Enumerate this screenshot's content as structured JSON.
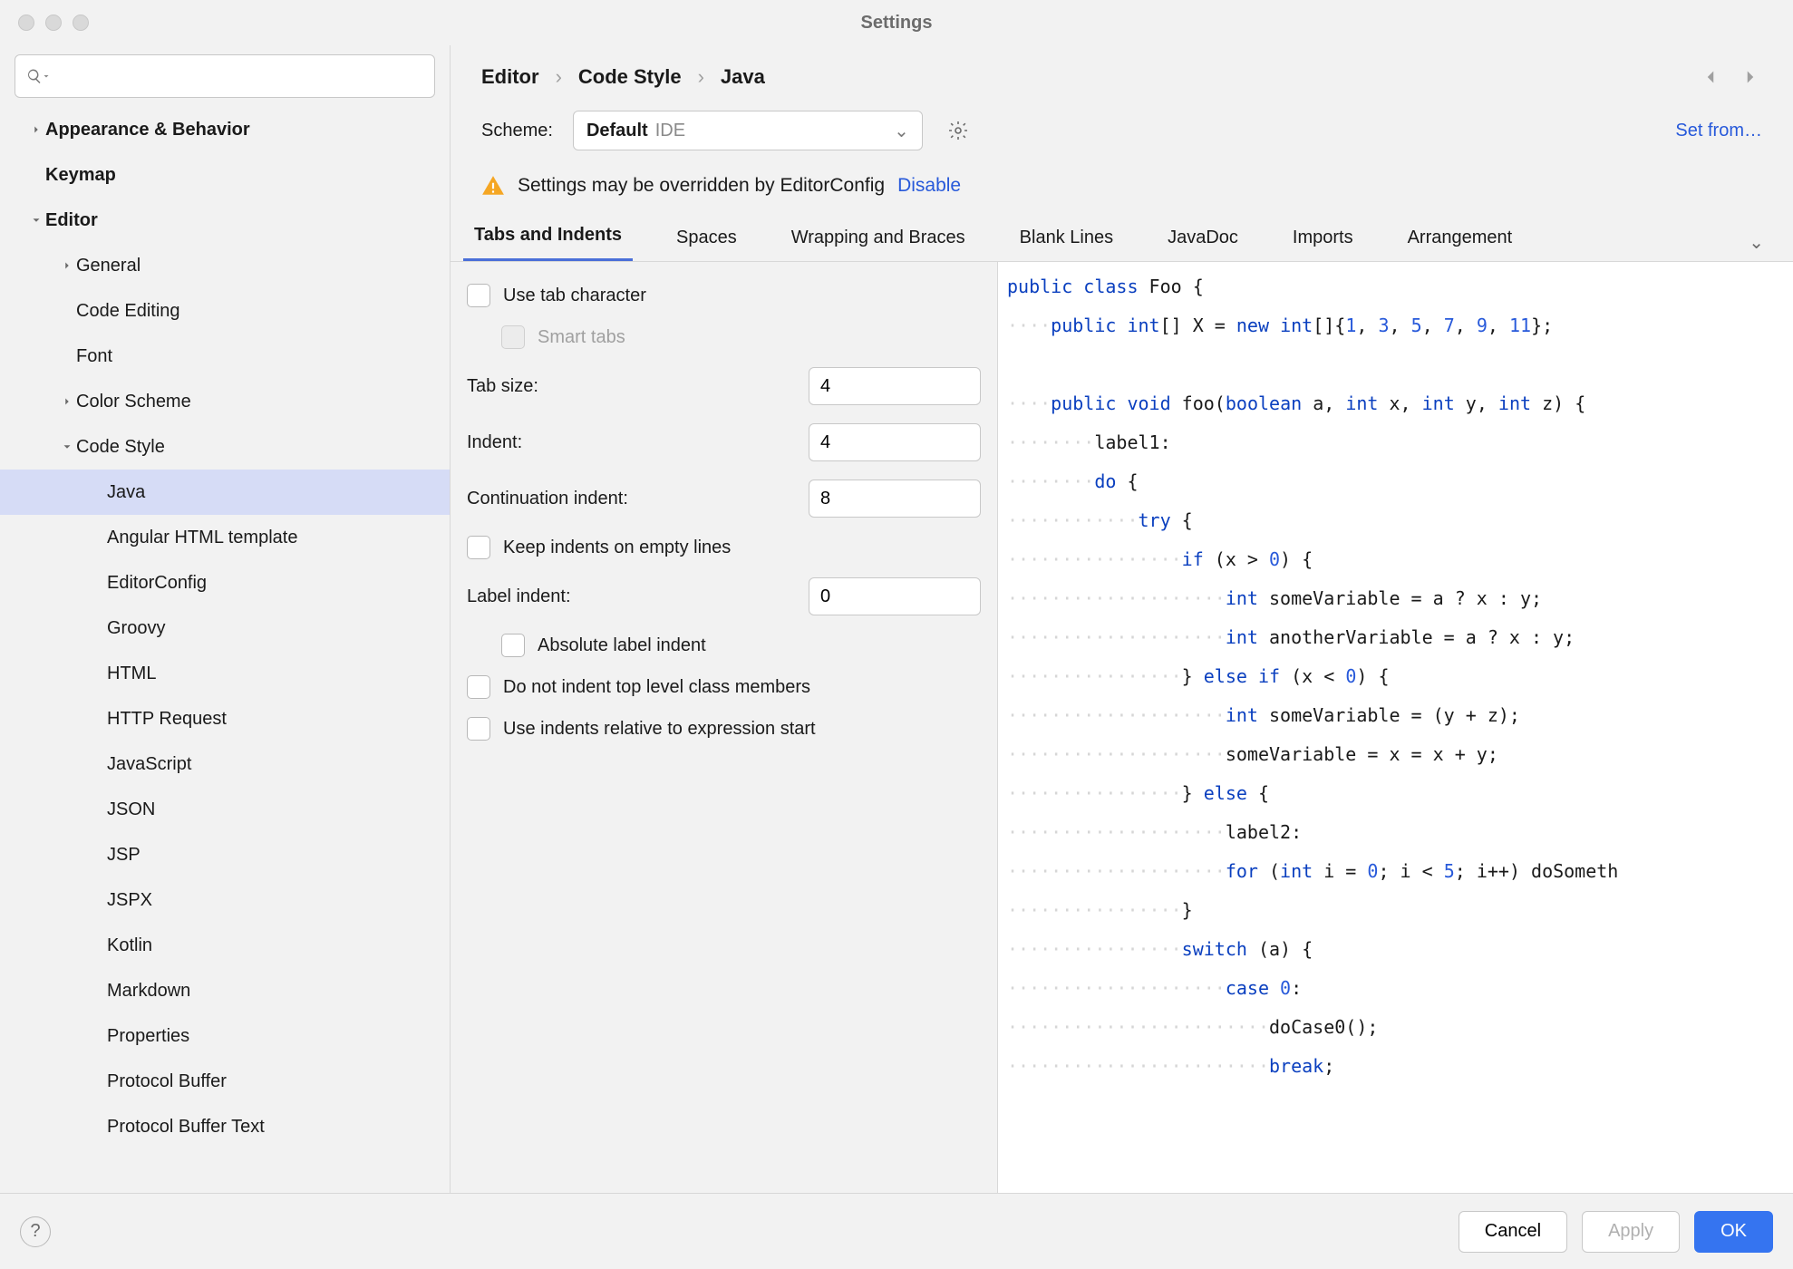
{
  "window": {
    "title": "Settings"
  },
  "sidebar": {
    "items": [
      {
        "label": "Appearance & Behavior",
        "bold": true,
        "depth": 0,
        "chev": "right"
      },
      {
        "label": "Keymap",
        "bold": true,
        "depth": 0
      },
      {
        "label": "Editor",
        "bold": true,
        "depth": 0,
        "chev": "down"
      },
      {
        "label": "General",
        "depth": 1,
        "chev": "right"
      },
      {
        "label": "Code Editing",
        "depth": 1
      },
      {
        "label": "Font",
        "depth": 1
      },
      {
        "label": "Color Scheme",
        "depth": 1,
        "chev": "right"
      },
      {
        "label": "Code Style",
        "depth": 1,
        "chev": "down"
      },
      {
        "label": "Java",
        "depth": 2,
        "selected": true
      },
      {
        "label": "Angular HTML template",
        "depth": 2
      },
      {
        "label": "EditorConfig",
        "depth": 2
      },
      {
        "label": "Groovy",
        "depth": 2
      },
      {
        "label": "HTML",
        "depth": 2
      },
      {
        "label": "HTTP Request",
        "depth": 2
      },
      {
        "label": "JavaScript",
        "depth": 2
      },
      {
        "label": "JSON",
        "depth": 2
      },
      {
        "label": "JSP",
        "depth": 2
      },
      {
        "label": "JSPX",
        "depth": 2
      },
      {
        "label": "Kotlin",
        "depth": 2
      },
      {
        "label": "Markdown",
        "depth": 2
      },
      {
        "label": "Properties",
        "depth": 2
      },
      {
        "label": "Protocol Buffer",
        "depth": 2
      },
      {
        "label": "Protocol Buffer Text",
        "depth": 2
      }
    ]
  },
  "breadcrumbs": [
    "Editor",
    "Code Style",
    "Java"
  ],
  "scheme": {
    "label": "Scheme:",
    "value": "Default",
    "suffix": "IDE"
  },
  "set_from": "Set from…",
  "warning": {
    "text": "Settings may be overridden by EditorConfig",
    "link": "Disable"
  },
  "tabs": [
    "Tabs and Indents",
    "Spaces",
    "Wrapping and Braces",
    "Blank Lines",
    "JavaDoc",
    "Imports",
    "Arrangement"
  ],
  "active_tab": 0,
  "form": {
    "use_tab_char": {
      "label": "Use tab character",
      "checked": false
    },
    "smart_tabs": {
      "label": "Smart tabs",
      "checked": false,
      "disabled": true
    },
    "tab_size": {
      "label": "Tab size:",
      "value": "4"
    },
    "indent": {
      "label": "Indent:",
      "value": "4"
    },
    "cont_indent": {
      "label": "Continuation indent:",
      "value": "8"
    },
    "keep_empty": {
      "label": "Keep indents on empty lines",
      "checked": false
    },
    "label_indent": {
      "label": "Label indent:",
      "value": "0"
    },
    "abs_label": {
      "label": "Absolute label indent",
      "checked": false
    },
    "no_top_level": {
      "label": "Do not indent top level class members",
      "checked": false
    },
    "rel_expr": {
      "label": "Use indents relative to expression start",
      "checked": false
    }
  },
  "footer": {
    "cancel": "Cancel",
    "apply": "Apply",
    "ok": "OK"
  },
  "code": {
    "l1a": "public",
    "l1b": " ",
    "l1c": "class",
    "l1d": " Foo {",
    "ws4": "····",
    "l2a": "public",
    "l2b": " ",
    "l2c": "int",
    "l2d": "[] X = ",
    "l2e": "new",
    "l2f": " ",
    "l2g": "int",
    "l2h": "[]{",
    "l2i": "1",
    "l2j": ", ",
    "l2k": "3",
    "l2l": ", ",
    "l2m": "5",
    "l2n": ", ",
    "l2o": "7",
    "l2p": ", ",
    "l2q": "9",
    "l2r": ", ",
    "l2s": "11",
    "l2t": "};",
    "l3a": "public",
    "l3b": " ",
    "l3c": "void",
    "l3d": " foo(",
    "l3e": "boolean",
    "l3f": " a, ",
    "l3g": "int",
    "l3h": " x, ",
    "l3i": "int",
    "l3j": " y, ",
    "l3k": "int",
    "l3l": " z) {",
    "ws8": "········",
    "l4": "label1:",
    "l5a": "do",
    "l5b": " {",
    "ws12": "············",
    "l6a": "try",
    "l6b": " {",
    "ws16": "················",
    "l7a": "if",
    "l7b": " (x > ",
    "l7c": "0",
    "l7d": ") {",
    "ws20": "····················",
    "l8a": "int",
    "l8b": " someVariable = a ? x : y;",
    "l9a": "int",
    "l9b": " anotherVariable = a ? x : y;",
    "l10a": "} ",
    "l10b": "else",
    "l10c": " ",
    "l10d": "if",
    "l10e": " (x < ",
    "l10f": "0",
    "l10g": ") {",
    "l11a": "int",
    "l11b": " someVariable = (y + z);",
    "l12": "someVariable = x = x + y;",
    "l13a": "} ",
    "l13b": "else",
    "l13c": " {",
    "l14": "label2:",
    "l15a": "for",
    "l15b": " (",
    "l15c": "int",
    "l15d": " i = ",
    "l15e": "0",
    "l15f": "; i < ",
    "l15g": "5",
    "l15h": "; i++) doSometh",
    "l16": "}",
    "l17a": "switch",
    "l17b": " (a) {",
    "l18a": "case",
    "l18b": " ",
    "l18c": "0",
    "l18d": ":",
    "ws24": "························",
    "l19": "doCase0();",
    "l20a": "break",
    "l20b": ";"
  }
}
